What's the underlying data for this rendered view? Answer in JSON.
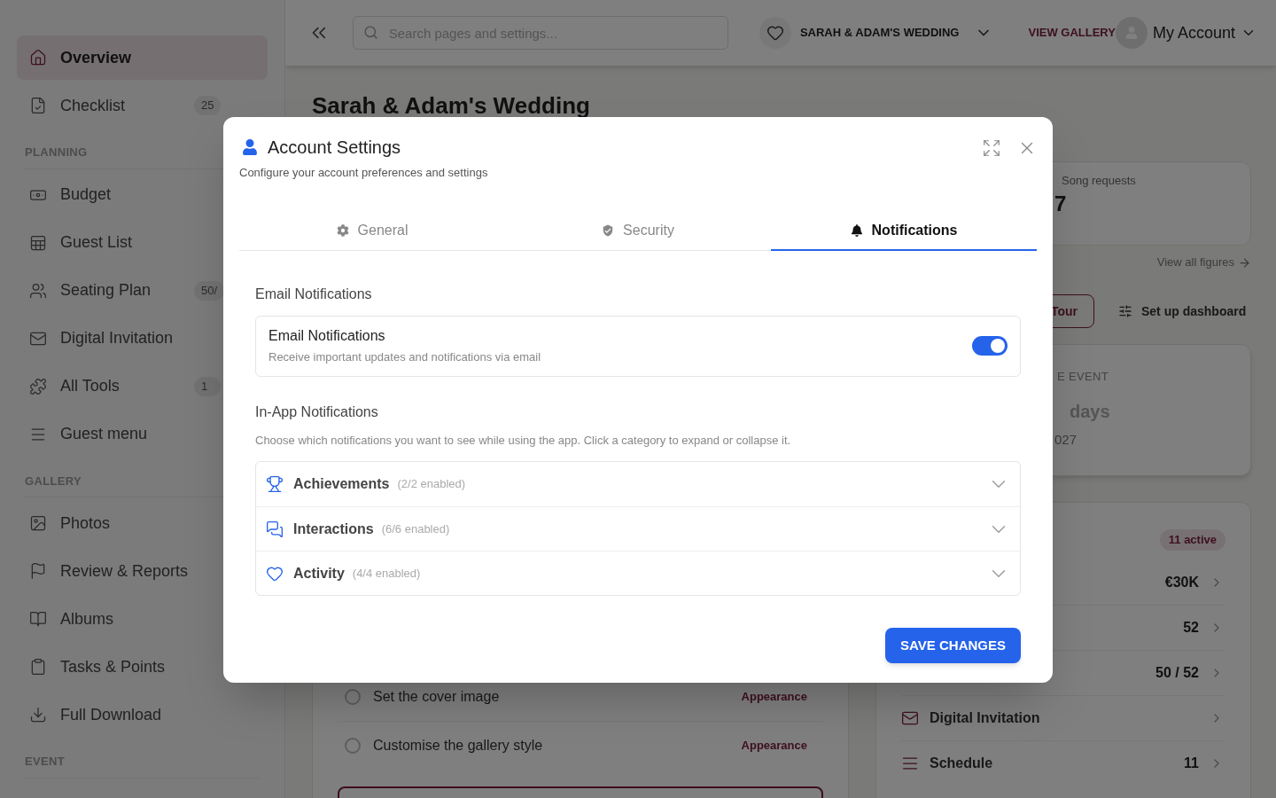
{
  "sidebar": {
    "items": [
      {
        "label": "Overview",
        "selected": true
      },
      {
        "label": "Checklist",
        "selected": false,
        "badge": "25"
      }
    ],
    "sections": [
      {
        "heading": "PLANNING",
        "items": [
          {
            "label": "Budget",
            "selected": false
          },
          {
            "label": "Guest List",
            "selected": false
          },
          {
            "label": "Seating Plan",
            "selected": false,
            "badge": "50/"
          },
          {
            "label": "Digital Invitation",
            "selected": false
          },
          {
            "label": "All Tools",
            "selected": false,
            "badge": "1"
          },
          {
            "label": "Guest menu",
            "selected": false
          }
        ]
      },
      {
        "heading": "GALLERY",
        "items": [
          {
            "label": "Photos",
            "selected": false
          },
          {
            "label": "Review & Reports",
            "selected": false
          },
          {
            "label": "Albums",
            "selected": false
          },
          {
            "label": "Tasks & Points",
            "selected": false
          },
          {
            "label": "Full Download",
            "selected": false
          }
        ]
      },
      {
        "heading": "EVENT"
      }
    ]
  },
  "header": {
    "search_placeholder": "Search pages and settings...",
    "event_name": "SARAH & ADAM'S WEDDING",
    "view_gallery": "VIEW GALLERY",
    "account": "My Account"
  },
  "page_title": "Sarah & Adam's Wedding",
  "checklist": {
    "tasks": [
      {
        "label": "Set the cover image",
        "tag": "Appearance",
        "checked": false
      },
      {
        "label": "Customise the gallery style",
        "tag": "Appearance",
        "checked": false
      }
    ]
  },
  "stats": {
    "value": "7",
    "label": "Song requests"
  },
  "view_all": "View all figures",
  "tour_button": "Tour",
  "setup_button": "Set up dashboard",
  "countdown": {
    "label": "E EVENT",
    "unit": "days",
    "date": "027"
  },
  "tools": {
    "badge": "11 active",
    "rows": [
      {
        "value": "€30K"
      },
      {
        "value": "52"
      },
      {
        "value": "50 / 52"
      },
      {
        "label": "Digital Invitation"
      },
      {
        "label": "Schedule",
        "value": "11"
      }
    ]
  },
  "modal": {
    "title": "Account Settings",
    "subtitle": "Configure your account preferences and settings",
    "tabs": [
      {
        "label": "General",
        "selected": false
      },
      {
        "label": "Security",
        "selected": false
      },
      {
        "label": "Notifications",
        "selected": true
      }
    ],
    "email": {
      "heading": "Email Notifications",
      "title": "Email Notifications",
      "description": "Receive important updates and notifications via email",
      "on": true
    },
    "in_app": {
      "heading": "In-App Notifications",
      "description": "Choose which notifications you want to see while using the app. Click a category to expand or collapse it.",
      "categories": [
        {
          "name": "Achievements",
          "count": "(2/2 enabled)",
          "expanded": false
        },
        {
          "name": "Interactions",
          "count": "(6/6 enabled)",
          "expanded": false
        },
        {
          "name": "Activity",
          "count": "(4/4 enabled)",
          "expanded": false
        }
      ]
    },
    "save": "SAVE CHANGES"
  }
}
